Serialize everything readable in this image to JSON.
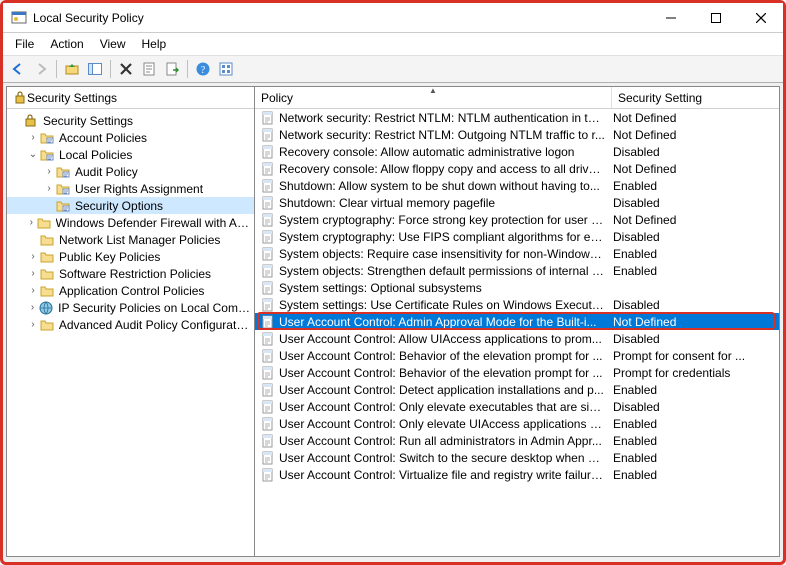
{
  "window": {
    "title": "Local Security Policy"
  },
  "menu": {
    "file": "File",
    "action": "Action",
    "view": "View",
    "help": "Help"
  },
  "tree_header": "Security Settings",
  "tree": [
    {
      "indent": 0,
      "expander": "",
      "icon": "root",
      "label": "Security Settings",
      "selected": false
    },
    {
      "indent": 1,
      "expander": ">",
      "icon": "folder-policy",
      "label": "Account Policies",
      "selected": false
    },
    {
      "indent": 1,
      "expander": "v",
      "icon": "folder-policy",
      "label": "Local Policies",
      "selected": false
    },
    {
      "indent": 2,
      "expander": ">",
      "icon": "folder-policy",
      "label": "Audit Policy",
      "selected": false
    },
    {
      "indent": 2,
      "expander": ">",
      "icon": "folder-policy",
      "label": "User Rights Assignment",
      "selected": false
    },
    {
      "indent": 2,
      "expander": "",
      "icon": "folder-policy",
      "label": "Security Options",
      "selected": true
    },
    {
      "indent": 1,
      "expander": ">",
      "icon": "folder",
      "label": "Windows Defender Firewall with Advanced Security",
      "selected": false
    },
    {
      "indent": 1,
      "expander": "",
      "icon": "folder",
      "label": "Network List Manager Policies",
      "selected": false
    },
    {
      "indent": 1,
      "expander": ">",
      "icon": "folder",
      "label": "Public Key Policies",
      "selected": false
    },
    {
      "indent": 1,
      "expander": ">",
      "icon": "folder",
      "label": "Software Restriction Policies",
      "selected": false
    },
    {
      "indent": 1,
      "expander": ">",
      "icon": "folder",
      "label": "Application Control Policies",
      "selected": false
    },
    {
      "indent": 1,
      "expander": ">",
      "icon": "ipsec",
      "label": "IP Security Policies on Local Computer",
      "selected": false
    },
    {
      "indent": 1,
      "expander": ">",
      "icon": "folder",
      "label": "Advanced Audit Policy Configuration",
      "selected": false
    }
  ],
  "list_headers": {
    "policy": "Policy",
    "setting": "Security Setting"
  },
  "policies": [
    {
      "name": "Network security: Restrict NTLM: NTLM authentication in thi...",
      "setting": "Not Defined",
      "selected": false
    },
    {
      "name": "Network security: Restrict NTLM: Outgoing NTLM traffic to r...",
      "setting": "Not Defined",
      "selected": false
    },
    {
      "name": "Recovery console: Allow automatic administrative logon",
      "setting": "Disabled",
      "selected": false
    },
    {
      "name": "Recovery console: Allow floppy copy and access to all drives...",
      "setting": "Not Defined",
      "selected": false
    },
    {
      "name": "Shutdown: Allow system to be shut down without having to...",
      "setting": "Enabled",
      "selected": false
    },
    {
      "name": "Shutdown: Clear virtual memory pagefile",
      "setting": "Disabled",
      "selected": false
    },
    {
      "name": "System cryptography: Force strong key protection for user k...",
      "setting": "Not Defined",
      "selected": false
    },
    {
      "name": "System cryptography: Use FIPS compliant algorithms for en...",
      "setting": "Disabled",
      "selected": false
    },
    {
      "name": "System objects: Require case insensitivity for non-Windows ...",
      "setting": "Enabled",
      "selected": false
    },
    {
      "name": "System objects: Strengthen default permissions of internal s...",
      "setting": "Enabled",
      "selected": false
    },
    {
      "name": "System settings: Optional subsystems",
      "setting": "",
      "selected": false
    },
    {
      "name": "System settings: Use Certificate Rules on Windows Executab...",
      "setting": "Disabled",
      "selected": false
    },
    {
      "name": "User Account Control: Admin Approval Mode for the Built-i...",
      "setting": "Not Defined",
      "selected": true
    },
    {
      "name": "User Account Control: Allow UIAccess applications to prom...",
      "setting": "Disabled",
      "selected": false
    },
    {
      "name": "User Account Control: Behavior of the elevation prompt for ...",
      "setting": "Prompt for consent for ...",
      "selected": false
    },
    {
      "name": "User Account Control: Behavior of the elevation prompt for ...",
      "setting": "Prompt for credentials",
      "selected": false
    },
    {
      "name": "User Account Control: Detect application installations and p...",
      "setting": "Enabled",
      "selected": false
    },
    {
      "name": "User Account Control: Only elevate executables that are sig...",
      "setting": "Disabled",
      "selected": false
    },
    {
      "name": "User Account Control: Only elevate UIAccess applications th...",
      "setting": "Enabled",
      "selected": false
    },
    {
      "name": "User Account Control: Run all administrators in Admin Appr...",
      "setting": "Enabled",
      "selected": false
    },
    {
      "name": "User Account Control: Switch to the secure desktop when pr...",
      "setting": "Enabled",
      "selected": false
    },
    {
      "name": "User Account Control: Virtualize file and registry write failure...",
      "setting": "Enabled",
      "selected": false
    }
  ]
}
